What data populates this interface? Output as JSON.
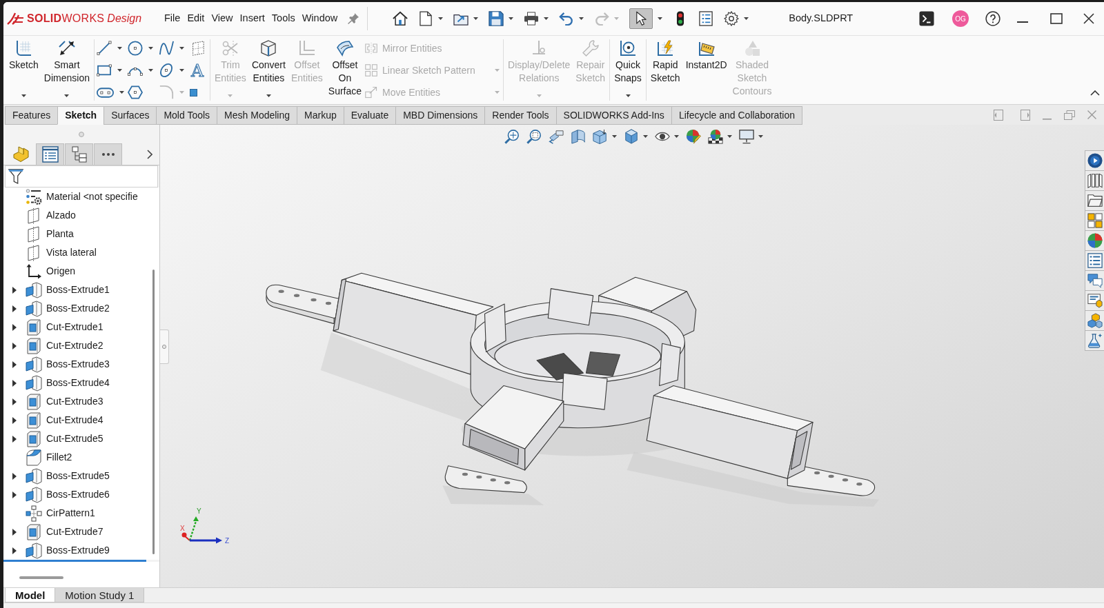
{
  "title_bar": {
    "logo": {
      "name": "**SOLID**WORKS",
      "edition": "Design"
    },
    "menu": [
      "File",
      "Edit",
      "View",
      "Insert",
      "Tools",
      "Window"
    ],
    "quick_access": [
      {
        "kind": "home",
        "dropdown": false,
        "selected": false,
        "disabled": false
      },
      {
        "kind": "new",
        "dropdown": true,
        "selected": false,
        "disabled": false
      },
      {
        "kind": "open",
        "dropdown": true,
        "selected": false,
        "disabled": false
      },
      {
        "kind": "save",
        "dropdown": true,
        "selected": false,
        "disabled": false
      },
      {
        "kind": "print",
        "dropdown": true,
        "selected": false,
        "disabled": false
      },
      {
        "kind": "undo",
        "dropdown": true,
        "selected": false,
        "disabled": false
      },
      {
        "kind": "redo",
        "dropdown": true,
        "selected": false,
        "disabled": true
      },
      {
        "kind": "select",
        "dropdown": true,
        "selected": true,
        "disabled": false
      },
      {
        "kind": "rebuild",
        "dropdown": false,
        "selected": false,
        "disabled": false
      },
      {
        "kind": "properties",
        "dropdown": false,
        "selected": false,
        "disabled": false
      },
      {
        "kind": "options",
        "dropdown": true,
        "selected": false,
        "disabled": false
      }
    ],
    "document_title": "Body.SLDPRT",
    "user_initials": "OG"
  },
  "ribbon": {
    "groups": [
      {
        "sections": [
          {
            "kind": "large",
            "commands": [
              {
                "kind": "sketch",
                "label": "Sketch",
                "disabled": false,
                "dropdown": true
              },
              {
                "kind": "dimension",
                "label": "Smart\nDimension",
                "disabled": false,
                "dropdown": true
              }
            ]
          }
        ]
      },
      {
        "sections": [
          {
            "kind": "grid",
            "tools": [
              {
                "kind": "line",
                "dropdown": true,
                "disabled": false
              },
              {
                "kind": "circle",
                "dropdown": true,
                "disabled": false
              },
              {
                "kind": "spline",
                "dropdown": true,
                "disabled": false
              },
              {
                "kind": "plane",
                "dropdown": false,
                "disabled": false
              },
              {
                "kind": "rectangle",
                "dropdown": true,
                "disabled": false
              },
              {
                "kind": "arc",
                "dropdown": true,
                "disabled": false
              },
              {
                "kind": "ellipse",
                "dropdown": true,
                "disabled": false
              },
              {
                "kind": "text",
                "glyph": "A",
                "dropdown": false,
                "disabled": false
              },
              {
                "kind": "slot",
                "dropdown": true,
                "disabled": false
              },
              {
                "kind": "polygon",
                "dropdown": false,
                "disabled": false
              },
              {
                "kind": "fillet",
                "dropdown": true,
                "disabled": true
              },
              {
                "kind": "point",
                "dropdown": false,
                "disabled": false
              }
            ]
          }
        ]
      },
      {
        "sections": [
          {
            "kind": "large",
            "commands": [
              {
                "kind": "trim",
                "label": "Trim\nEntities",
                "disabled": true,
                "dropdown": true
              },
              {
                "kind": "convert",
                "label": "Convert\nEntities",
                "disabled": false,
                "dropdown": true
              },
              {
                "kind": "offset",
                "label": "Offset\nEntities",
                "disabled": true,
                "dropdown": false
              },
              {
                "kind": "surfaceoffset",
                "label": "Offset\nOn\nSurface",
                "disabled": false,
                "dropdown": false
              }
            ]
          },
          {
            "kind": "list",
            "commands": [
              {
                "kind": "mirror",
                "label": "Mirror Entities",
                "disabled": true,
                "dropdown": false
              },
              {
                "kind": "pattern",
                "label": "Linear Sketch Pattern",
                "disabled": true,
                "dropdown": true
              },
              {
                "kind": "move",
                "label": "Move Entities",
                "disabled": true,
                "dropdown": true
              }
            ]
          }
        ]
      },
      {
        "sections": [
          {
            "kind": "large",
            "commands": [
              {
                "kind": "relations",
                "label": "Display/Delete\nRelations",
                "disabled": true,
                "dropdown": true
              },
              {
                "kind": "repair",
                "label": "Repair\nSketch",
                "disabled": true,
                "dropdown": false
              }
            ]
          }
        ]
      },
      {
        "sections": [
          {
            "kind": "large",
            "commands": [
              {
                "kind": "snaps",
                "label": "Quick\nSnaps",
                "disabled": false,
                "dropdown": true
              }
            ]
          }
        ]
      },
      {
        "sections": [
          {
            "kind": "large",
            "commands": [
              {
                "kind": "rapid",
                "label": "Rapid\nSketch",
                "disabled": false,
                "dropdown": false
              },
              {
                "kind": "instant2d",
                "label": "Instant2D",
                "disabled": false,
                "dropdown": false
              },
              {
                "kind": "contours",
                "label": "Shaded\nSketch\nContours",
                "disabled": true,
                "dropdown": false
              }
            ]
          }
        ]
      }
    ]
  },
  "command_tabs": [
    {
      "label": "Features",
      "selected": false
    },
    {
      "label": "Sketch",
      "selected": true
    },
    {
      "label": "Surfaces",
      "selected": false
    },
    {
      "label": "Mold Tools",
      "selected": false
    },
    {
      "label": "Mesh Modeling",
      "selected": false
    },
    {
      "label": "Markup",
      "selected": false
    },
    {
      "label": "Evaluate",
      "selected": false
    },
    {
      "label": "MBD Dimensions",
      "selected": false
    },
    {
      "label": "Render Tools",
      "selected": false
    },
    {
      "label": "SOLIDWORKS Add-Ins",
      "selected": false
    },
    {
      "label": "Lifecycle and Collaboration",
      "selected": false
    }
  ],
  "feature_panel": {
    "tabs": [
      {
        "kind": "features",
        "selected": true
      },
      {
        "kind": "properties",
        "selected": false
      },
      {
        "kind": "configurations",
        "selected": false
      },
      {
        "kind": "more",
        "selected": false
      }
    ],
    "tree": [
      {
        "label": "Material <not specifie",
        "kind": "material",
        "expandable": false
      },
      {
        "label": "Alzado",
        "kind": "plane",
        "expandable": false
      },
      {
        "label": "Planta",
        "kind": "plane",
        "expandable": false
      },
      {
        "label": "Vista lateral",
        "kind": "plane",
        "expandable": false
      },
      {
        "label": "Origen",
        "kind": "origin",
        "expandable": false
      },
      {
        "label": "Boss-Extrude1",
        "kind": "boss",
        "expandable": true
      },
      {
        "label": "Boss-Extrude2",
        "kind": "boss",
        "expandable": true
      },
      {
        "label": "Cut-Extrude1",
        "kind": "cut",
        "expandable": true
      },
      {
        "label": "Cut-Extrude2",
        "kind": "cut",
        "expandable": true
      },
      {
        "label": "Boss-Extrude3",
        "kind": "boss",
        "expandable": true
      },
      {
        "label": "Boss-Extrude4",
        "kind": "boss",
        "expandable": true
      },
      {
        "label": "Cut-Extrude3",
        "kind": "cut",
        "expandable": true
      },
      {
        "label": "Cut-Extrude4",
        "kind": "cut",
        "expandable": true
      },
      {
        "label": "Cut-Extrude5",
        "kind": "cut",
        "expandable": true
      },
      {
        "label": "Fillet2",
        "kind": "fillet",
        "expandable": false
      },
      {
        "label": "Boss-Extrude5",
        "kind": "boss",
        "expandable": true
      },
      {
        "label": "Boss-Extrude6",
        "kind": "boss",
        "expandable": true
      },
      {
        "label": "CirPattern1",
        "kind": "pattern",
        "expandable": false
      },
      {
        "label": "Cut-Extrude7",
        "kind": "cut",
        "expandable": true
      },
      {
        "label": "Boss-Extrude9",
        "kind": "boss",
        "expandable": true
      }
    ]
  },
  "graphics_area": {
    "heads_up_toolbar": [
      {
        "kind": "fit",
        "dropdown": false
      },
      {
        "kind": "area",
        "dropdown": false
      },
      {
        "kind": "previous",
        "dropdown": false
      },
      {
        "kind": "section",
        "dropdown": false
      },
      {
        "kind": "orientation",
        "dropdown": true
      },
      {
        "kind": "display",
        "dropdown": true
      },
      {
        "kind": "visibility",
        "dropdown": true
      },
      {
        "kind": "appearance",
        "dropdown": false
      },
      {
        "kind": "scene",
        "dropdown": true
      },
      {
        "kind": "settings",
        "dropdown": true
      }
    ],
    "task_pane": [
      {
        "kind": "resources"
      },
      {
        "kind": "library"
      },
      {
        "kind": "explorer"
      },
      {
        "kind": "palette"
      },
      {
        "kind": "appearances"
      },
      {
        "kind": "customproperties"
      },
      {
        "kind": "forum"
      },
      {
        "kind": "properties"
      },
      {
        "kind": "components"
      },
      {
        "kind": "simulation"
      }
    ],
    "triad": {
      "x": "X",
      "y": "Y",
      "z": "Z"
    }
  },
  "bottom_tabs": [
    {
      "label": "Model",
      "selected": true
    },
    {
      "label": "Motion Study 1",
      "selected": false
    }
  ]
}
